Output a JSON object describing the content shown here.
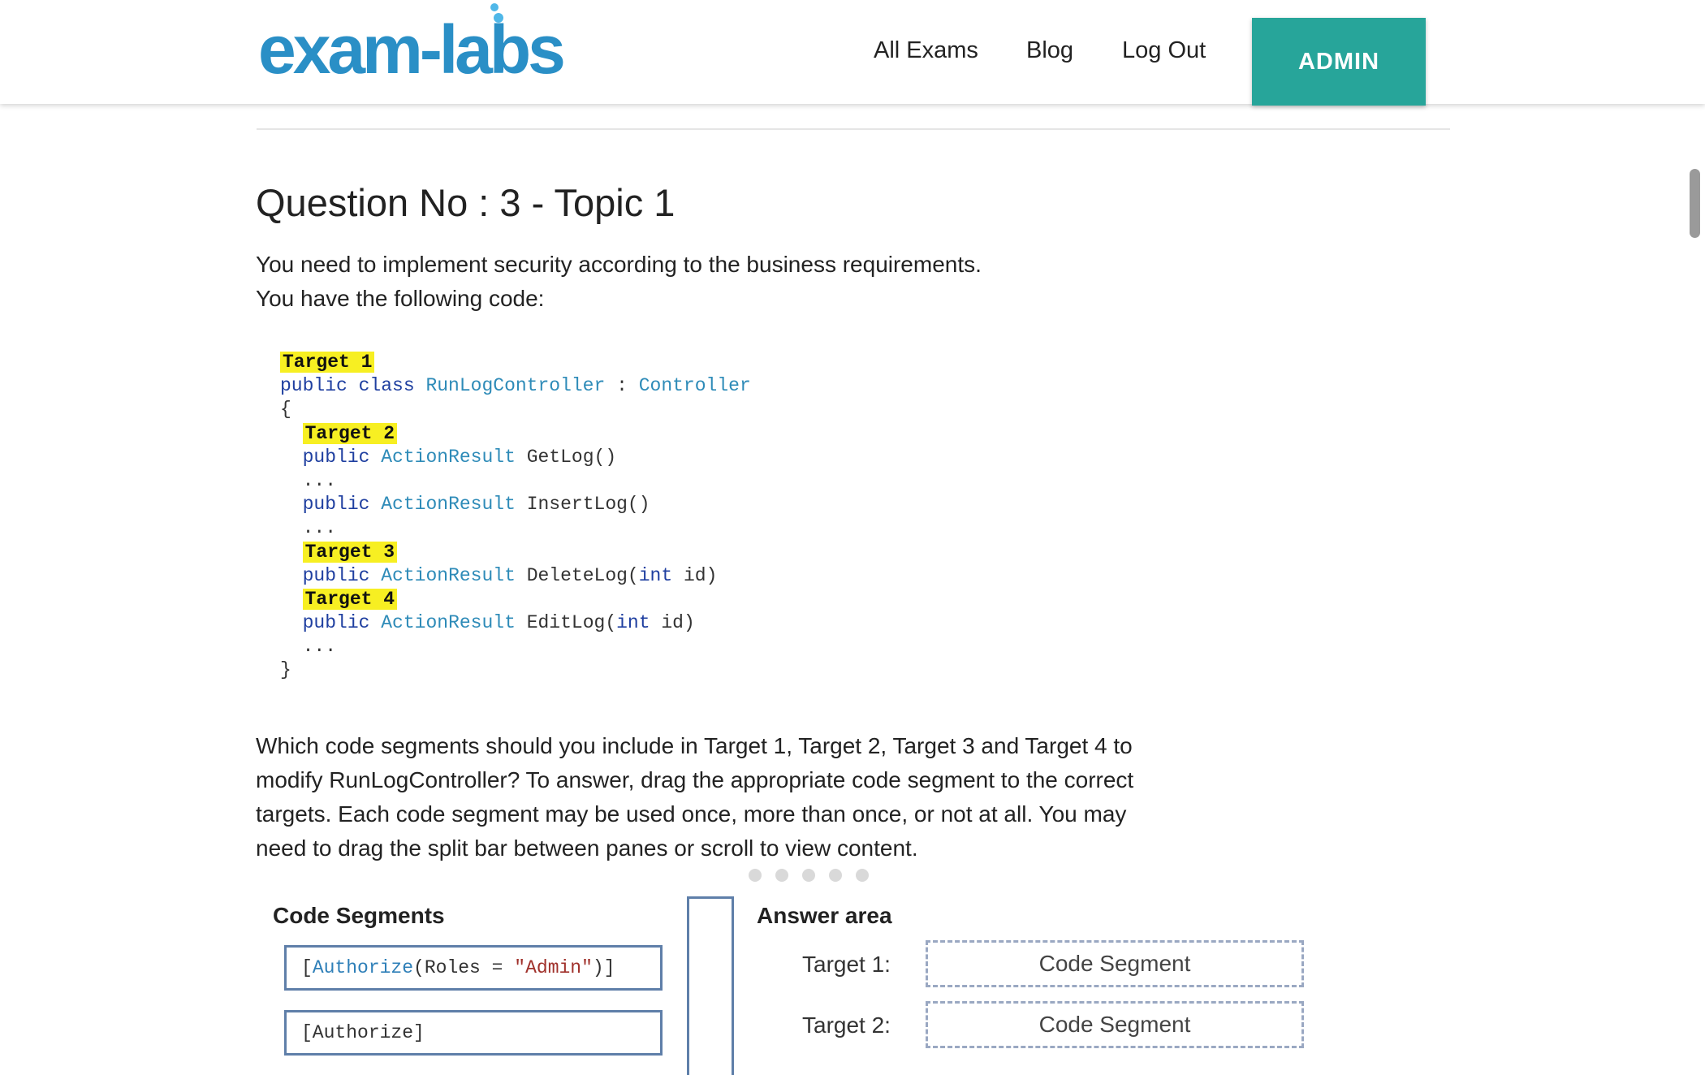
{
  "header": {
    "logo_text": "exam-labs",
    "nav": [
      {
        "label": "All Exams"
      },
      {
        "label": "Blog"
      },
      {
        "label": "Log Out"
      }
    ],
    "admin_label": "ADMIN"
  },
  "question": {
    "title": "Question No : 3 - Topic 1",
    "intro_line1": "You need to implement security according to the business requirements.",
    "intro_line2": "You have the following code:",
    "code": {
      "target1": "Target 1",
      "class_kw": "public class",
      "class_name": "RunLogController",
      "colon": " : ",
      "base_class": "Controller",
      "open_brace": "{",
      "target2": "Target 2",
      "public_kw": "public",
      "action_result": "ActionResult",
      "getlog": "GetLog()",
      "ellipsis": "...",
      "insertlog": "InsertLog()",
      "target3": "Target 3",
      "deletelog_pre": "DeleteLog(",
      "int_kw": "int",
      "id_close": "id)",
      "target4": "Target 4",
      "editlog_pre": "EditLog(",
      "close_brace": "}"
    },
    "body_lines": [
      "Which code segments should you include in Target 1, Target 2, Target 3 and Target 4 to",
      "modify RunLogController? To answer, drag the appropriate code segment to the correct",
      "targets. Each code segment may be used once, more than once, or not at all. You may",
      "need to drag the split bar between panes or scroll to view content."
    ]
  },
  "drag_drop": {
    "segments_heading": "Code Segments",
    "segments": [
      {
        "attr_open": "[",
        "attr_name": "Authorize",
        "attr_args_pre": "(Roles = ",
        "attr_string": "\"Admin\"",
        "attr_close": ")]"
      },
      {
        "text": "[Authorize]"
      }
    ],
    "answer_heading": "Answer area",
    "targets": [
      {
        "label": "Target 1:",
        "placeholder": "Code Segment"
      },
      {
        "label": "Target 2:",
        "placeholder": "Code Segment"
      }
    ]
  },
  "colors": {
    "accent": "#27a59a",
    "logo": "#2a8fc6",
    "highlight": "#f7ef22"
  }
}
